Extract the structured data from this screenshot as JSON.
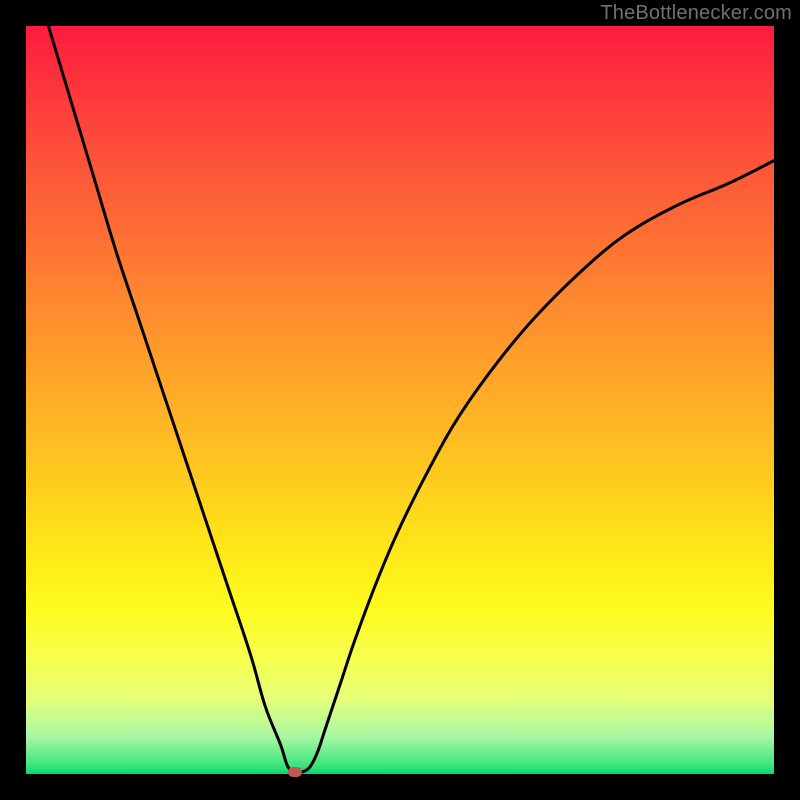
{
  "watermark": {
    "text": "TheBottlenecker.com"
  },
  "chart_data": {
    "type": "line",
    "title": "",
    "xlabel": "",
    "ylabel": "",
    "xlim": [
      0,
      100
    ],
    "ylim": [
      0,
      100
    ],
    "x": [
      3,
      6,
      9,
      12,
      15,
      18,
      21,
      24,
      27,
      30,
      32,
      34,
      35,
      36,
      37,
      38,
      39,
      40,
      42,
      44,
      47,
      50,
      54,
      58,
      63,
      68,
      74,
      80,
      87,
      94,
      100
    ],
    "values": [
      100,
      90,
      80,
      70,
      61,
      52,
      43,
      34,
      25,
      16,
      9,
      4,
      1,
      0.3,
      0.3,
      1,
      3,
      6,
      12,
      18,
      26,
      33,
      41,
      48,
      55,
      61,
      67,
      72,
      76,
      79,
      82
    ],
    "marker": {
      "x": 36,
      "y": 0.3
    },
    "background": "rainbow-vertical"
  }
}
